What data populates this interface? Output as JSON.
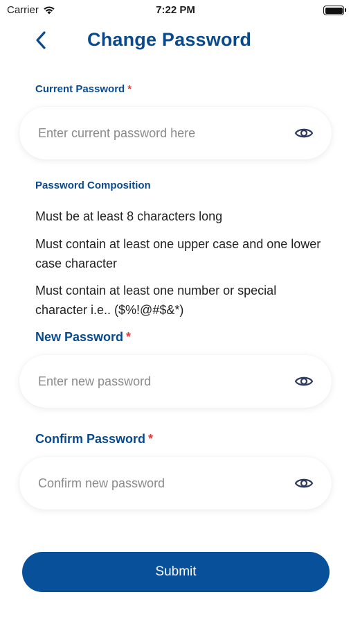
{
  "status_bar": {
    "carrier": "Carrier",
    "time": "7:22 PM"
  },
  "header": {
    "title": "Change Password",
    "back_icon": "chevron-left-icon"
  },
  "current_password": {
    "label": "Current Password",
    "required_mark": "*",
    "placeholder": "Enter current password here",
    "value": ""
  },
  "composition": {
    "title": "Password Composition",
    "rules": [
      "Must be at least 8 characters long",
      "Must contain at least one upper case and one lower case character",
      "Must contain at least one number or special character i.e.. ($%!@#$&*)"
    ]
  },
  "new_password": {
    "label": "New Password",
    "required_mark": "*",
    "placeholder": "Enter new password",
    "value": ""
  },
  "confirm_password": {
    "label": "Confirm Password",
    "required_mark": "*",
    "placeholder": "Confirm new password",
    "value": ""
  },
  "submit_label": "Submit",
  "colors": {
    "primary": "#0a4a8c",
    "button": "#08519a",
    "required": "#e53935",
    "eye_icon": "#2f3a5c"
  }
}
